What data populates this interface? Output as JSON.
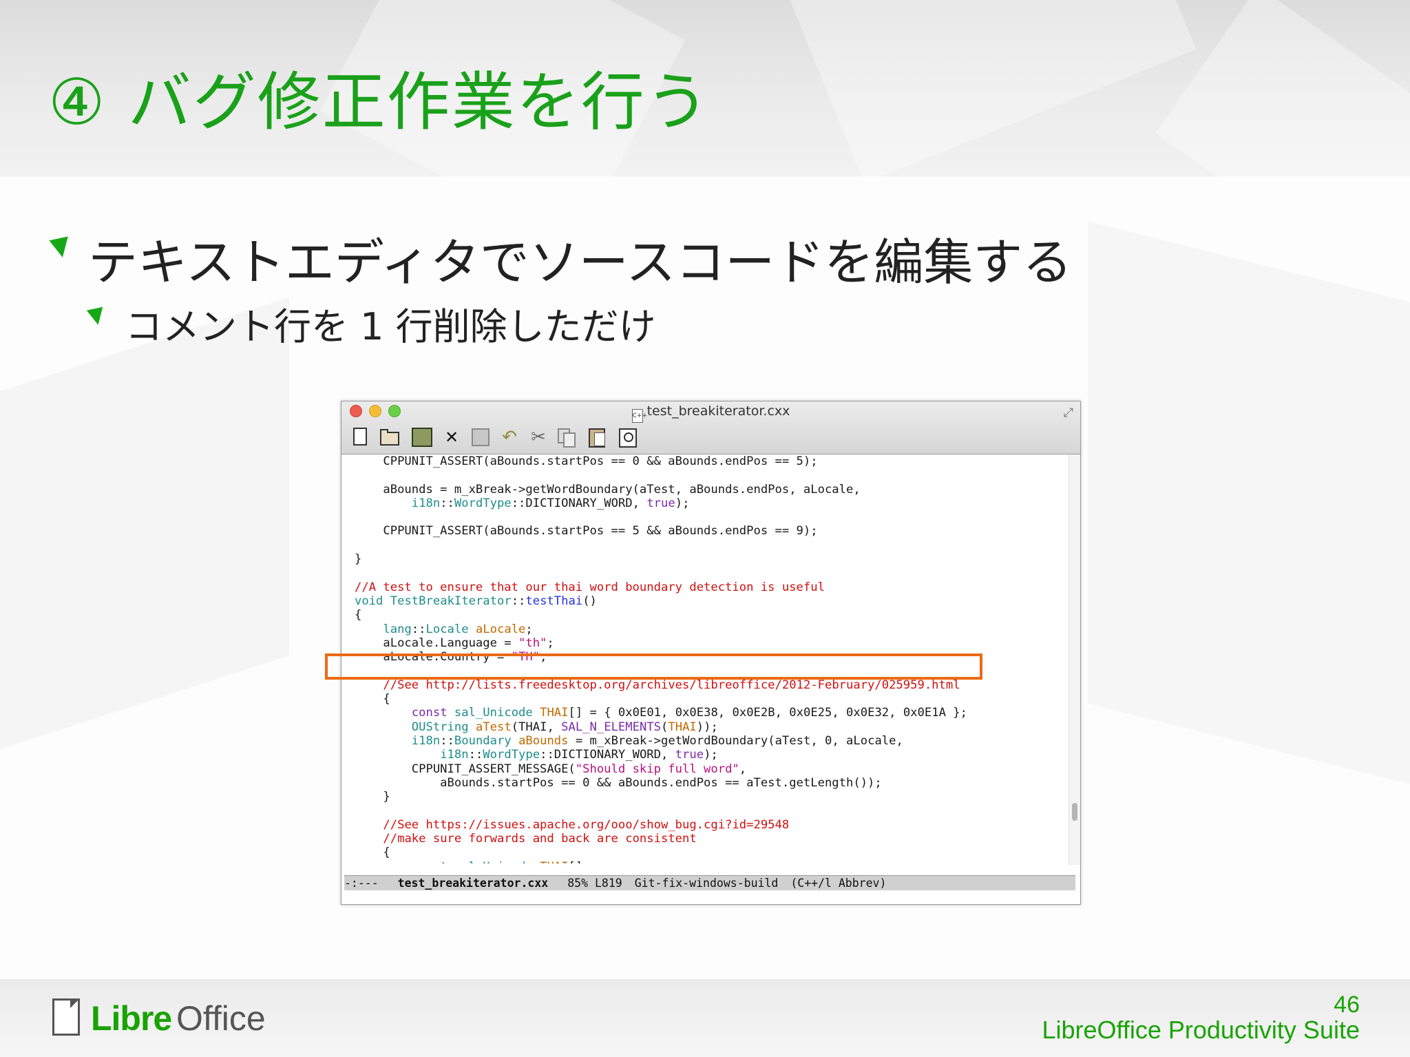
{
  "slide": {
    "title": "④ バグ修正作業を行う",
    "bullet1": "テキストエディタでソースコードを編集する",
    "bullet2": "コメント行を 1 行削除しただけ"
  },
  "editor": {
    "window_title": "test_breakiterator.cxx",
    "file_icon_glyph": "C++",
    "toolbar": {
      "icons": [
        "new-file-icon",
        "open-folder-icon",
        "dired-icon",
        "kill-buffer-icon",
        "save-icon",
        "undo-icon",
        "cut-icon",
        "copy-icon",
        "paste-icon",
        "search-icon"
      ],
      "kill_glyph": "✕",
      "undo_glyph": "↶",
      "cut_glyph": "✂"
    },
    "modeline": {
      "status": "-:---",
      "filename": "test_breakiterator.cxx",
      "position": "85% L819",
      "branch": "Git-fix-windows-build",
      "mode": "(C++/l Abbrev)"
    }
  },
  "footer": {
    "logo_libre": "Libre",
    "logo_office": "Office",
    "page_number": "46",
    "suite": "LibreOffice Productivity Suite"
  },
  "colors": {
    "accent_green": "#1aa11a",
    "highlight_orange": "#ec6a14",
    "comment_red": "#d0100f"
  }
}
